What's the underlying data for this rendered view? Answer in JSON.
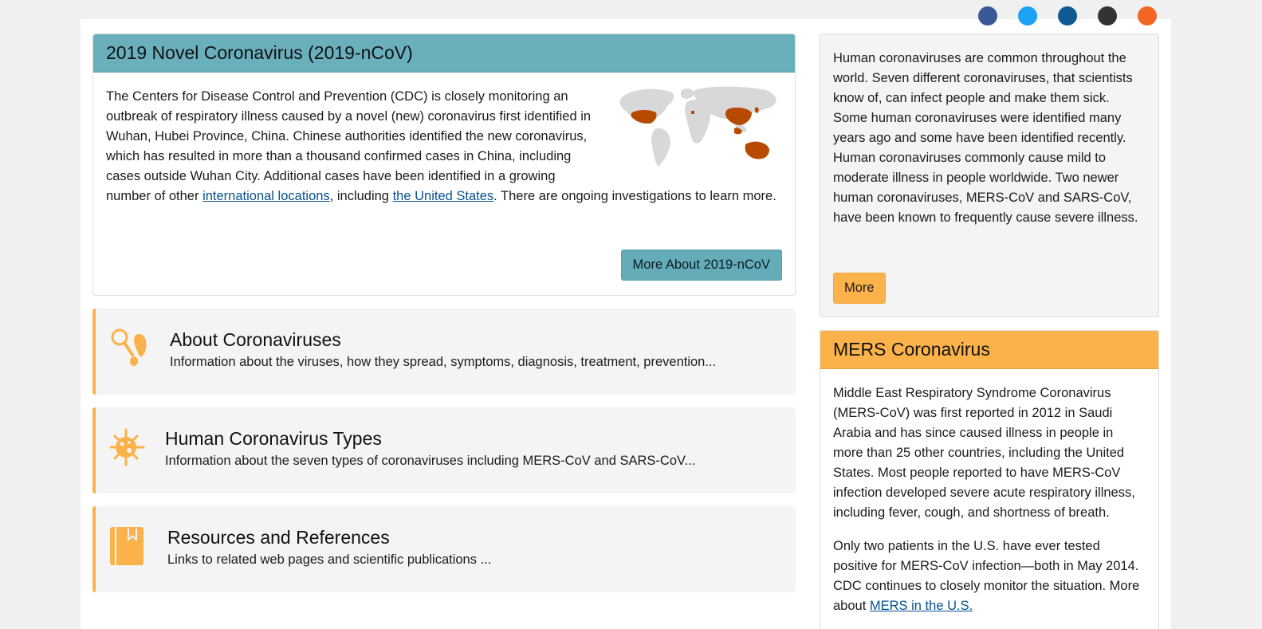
{
  "social": {
    "icons": [
      "facebook-icon",
      "twitter-icon",
      "linkedin-icon",
      "email-icon",
      "rss-icon"
    ],
    "colors": [
      "#3b5998",
      "#1da1f2",
      "#0e5a92",
      "#333333",
      "#f26522"
    ]
  },
  "feature": {
    "title": "2019 Novel Coronavirus (2019-nCoV)",
    "text_before_link1": "The Centers for Disease Control and Prevention (CDC) is closely monitoring an outbreak of respiratory illness caused by a novel (new) coronavirus first identified in Wuhan, Hubei Province, China. Chinese authorities identified the new coronavirus, which has resulted in more than a thousand confirmed cases in China, including cases outside Wuhan City. Additional cases have been identified in a growing number of other ",
    "link1": "international locations",
    "text_between": ", including ",
    "link2": "the United States",
    "text_after": ". There are ongoing investigations to learn more.",
    "button": "More About 2019-nCoV",
    "map_icon": "world-map-icon"
  },
  "cards": [
    {
      "icon": "magnifier-footprint-icon",
      "title": "About Coronaviruses",
      "desc": "Information about the viruses, how they spread, symptoms, diagnosis, treatment, prevention..."
    },
    {
      "icon": "virus-icon",
      "title": "Human Coronavirus Types",
      "desc": "Information about the seven types of coronaviruses including MERS-CoV and SARS-CoV..."
    },
    {
      "icon": "book-icon",
      "title": "Resources and References",
      "desc": "Links to related web pages and scientific publications ..."
    }
  ],
  "info": {
    "text": "Human coronaviruses are common throughout the world. Seven different coronaviruses, that scientists know of, can infect people and make them sick. Some human coronaviruses were identified many years ago and some have been identified recently. Human coronaviruses commonly cause mild to moderate illness in people worldwide. Two newer human coronaviruses, MERS-CoV and SARS-CoV, have been known to frequently cause severe illness.",
    "button": "More"
  },
  "mers": {
    "title": "MERS Coronavirus",
    "p1": "Middle East Respiratory Syndrome Coronavirus (MERS-CoV) was first reported in 2012 in Saudi Arabia and has since caused illness in people in more than 25 other countries, including the United States. Most people reported to have MERS-CoV infection developed severe acute respiratory illness, including fever, cough, and shortness of breath.",
    "p2_text": "Only two patients in the U.S. have ever tested positive for MERS-CoV infection—both in May 2014. CDC continues to closely monitor the situation. More about ",
    "p2_link": "MERS in the U.S."
  },
  "colors": {
    "teal": "#6ab0bc",
    "orange": "#fbb24a",
    "link": "#075290",
    "map_highlight": "#b84a00"
  }
}
